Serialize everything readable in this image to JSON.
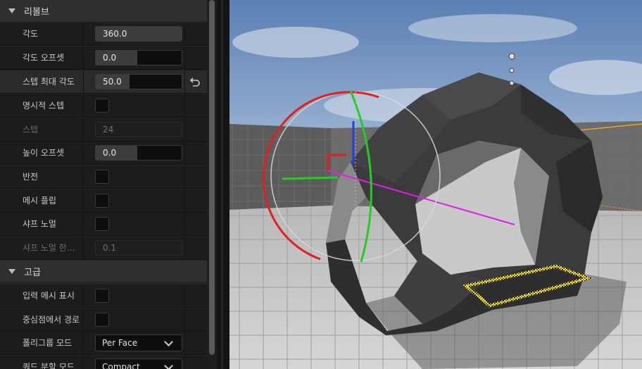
{
  "sections": {
    "revolve": {
      "title": "리볼브"
    },
    "advanced": {
      "title": "고급"
    }
  },
  "props": {
    "angle": {
      "label": "각도",
      "value": "360.0",
      "fill": 0.7
    },
    "angle_offset": {
      "label": "각도 오프셋",
      "value": "0.0",
      "fill": 0.4
    },
    "max_step_angle": {
      "label": "스텝 최대 각도",
      "value": "50.0",
      "fill": 0.4
    },
    "explicit_steps": {
      "label": "명시적 스텝",
      "checked": false
    },
    "steps": {
      "label": "스텝",
      "value": "24"
    },
    "height_offset": {
      "label": "높이 오프셋",
      "value": "0.0",
      "fill": 0.4
    },
    "reverse": {
      "label": "반전",
      "checked": false
    },
    "flip_mesh": {
      "label": "메시 플립",
      "checked": false
    },
    "sharp_normals": {
      "label": "샤프 노멀",
      "checked": false
    },
    "sharp_normal_threshold": {
      "label": "샤프 노멀 한...",
      "value": "0.1"
    },
    "show_input_mesh": {
      "label": "입력 메시 표시",
      "checked": false
    },
    "path_from_center": {
      "label": "중심점에서 경로",
      "checked": false
    },
    "polygroup_mode": {
      "label": "폴리그룹 모드",
      "value": "Per Face"
    },
    "quad_split_mode": {
      "label": "쿼드 분할 모드",
      "value": "Compact"
    }
  },
  "icons": {
    "reset": "reset-arrow-icon",
    "collapse": "triangle-down-icon",
    "dropdown": "chevron-down-icon"
  },
  "colors": {
    "gizmo_x": "#e02020",
    "gizmo_y": "#20d020",
    "gizmo_z": "#2040e0",
    "revolve_axis": "#e020e0",
    "selection": "#f0e020",
    "bounds": "#f0a020"
  }
}
